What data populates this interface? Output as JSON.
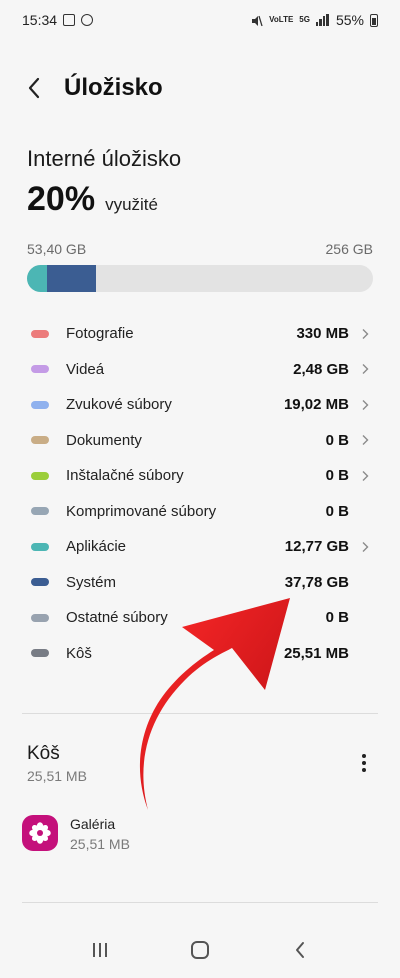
{
  "status_bar": {
    "time": "15:34",
    "network_mini_1": "VoLTE",
    "network_mini_2": "5G",
    "battery": "55%"
  },
  "header": {
    "title": "Úložisko",
    "back_icon": "back-arrow-icon"
  },
  "storage": {
    "section_title": "Interné úložisko",
    "percent": "20%",
    "used_label": "využité",
    "used_capacity": "53,40 GB",
    "total_capacity": "256 GB",
    "used_fraction": 0.2
  },
  "categories": [
    {
      "label": "Fotografie",
      "size": "330 MB",
      "color": "#ec7b7b",
      "chevron": true
    },
    {
      "label": "Videá",
      "size": "2,48 GB",
      "color": "#c49be6",
      "chevron": true
    },
    {
      "label": "Zvukové súbory",
      "size": "19,02 MB",
      "color": "#8fb1ee",
      "chevron": true
    },
    {
      "label": "Dokumenty",
      "size": "0 B",
      "color": "#c9ad86",
      "chevron": true
    },
    {
      "label": "Inštalačné súbory",
      "size": "0 B",
      "color": "#9bce3a",
      "chevron": true
    },
    {
      "label": "Komprimované súbory",
      "size": "0 B",
      "color": "#97a6b4",
      "chevron": false
    },
    {
      "label": "Aplikácie",
      "size": "12,77 GB",
      "color": "#4cb6b4",
      "chevron": true
    },
    {
      "label": "Systém",
      "size": "37,78 GB",
      "color": "#3b5d92",
      "chevron": false
    },
    {
      "label": "Ostatné súbory",
      "size": "0 B",
      "color": "#98a2af",
      "chevron": false
    },
    {
      "label": "Kôš",
      "size": "25,51 MB",
      "color": "#787c85",
      "chevron": false
    }
  ],
  "trash": {
    "title": "Kôš",
    "size": "25,51 MB",
    "more_icon": "more-vertical-icon",
    "apps": [
      {
        "name": "Galéria",
        "size": "25,51 MB",
        "icon": "gallery-flower-icon",
        "icon_color": "#c4107b"
      }
    ]
  },
  "nav_bar": {
    "recents_icon": "recents-icon",
    "home_icon": "home-icon",
    "back_icon": "back-icon"
  },
  "annotation": {
    "arrow_color": "#e3101b"
  }
}
